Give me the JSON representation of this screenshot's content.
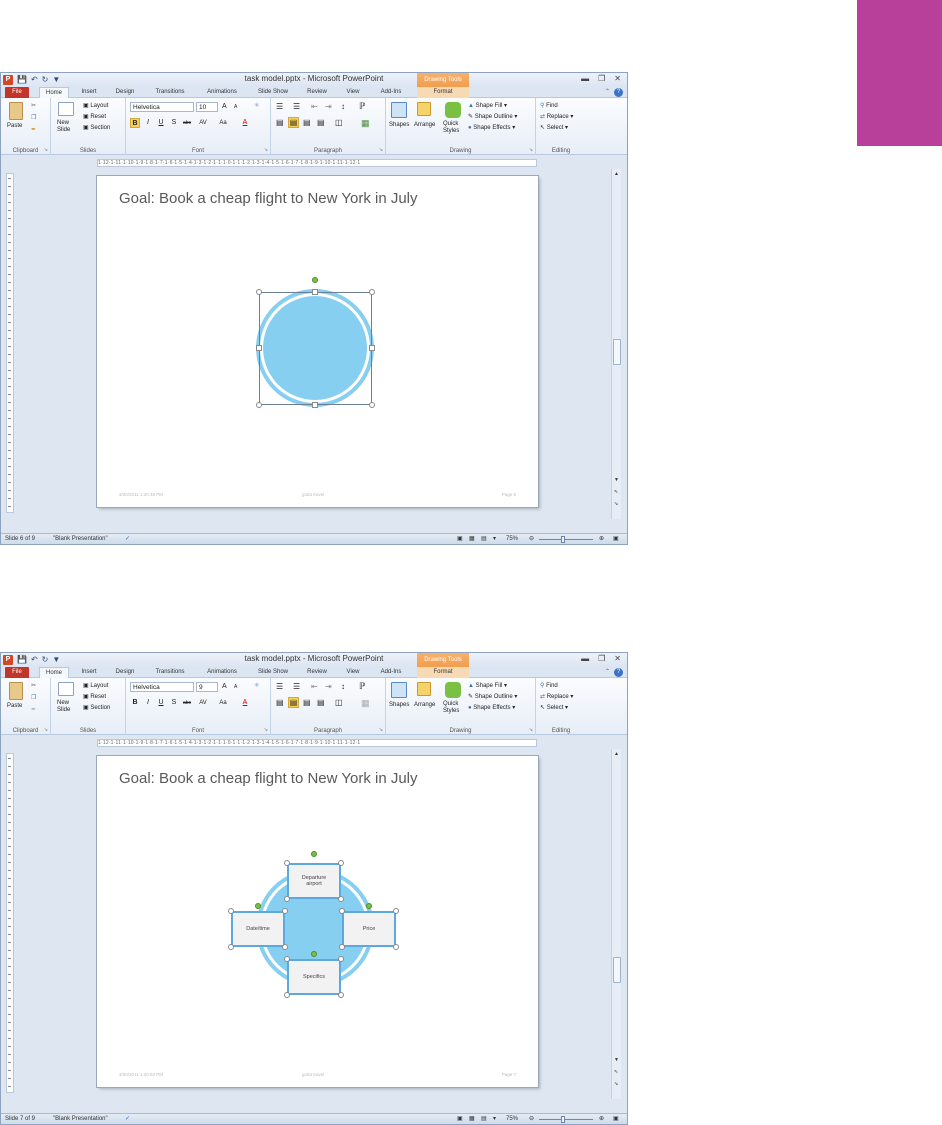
{
  "colors": {
    "accent_block": "#b8409a",
    "circle_fill": "#86cff0",
    "circle_ring": "#86cff0",
    "box_border": "#5ca9e2",
    "file_tab": "#c2352a",
    "drawing_tools_tab": "#f19d4d"
  },
  "windows": [
    {
      "title": "task model.pptx - Microsoft PowerPoint",
      "contextual_tab": "Drawing Tools",
      "tabs": [
        "File",
        "Home",
        "Insert",
        "Design",
        "Transitions",
        "Animations",
        "Slide Show",
        "Review",
        "View",
        "Add-Ins",
        "Format"
      ],
      "ribbon": {
        "clipboard": {
          "label": "Clipboard",
          "paste": "Paste"
        },
        "slides": {
          "label": "Slides",
          "new_slide": "New Slide",
          "layout": "Layout",
          "reset": "Reset",
          "section": "Section"
        },
        "font": {
          "label": "Font",
          "font_name": "Helvetica",
          "font_size": "10",
          "grow": "A",
          "shrink": "A",
          "bold": "B",
          "italic": "I",
          "underline": "U",
          "shadow": "S",
          "strike": "abc",
          "spacing": "AV",
          "case": "Aa",
          "color": "A"
        },
        "paragraph": {
          "label": "Paragraph"
        },
        "drawing": {
          "label": "Drawing",
          "shapes": "Shapes",
          "arrange": "Arrange",
          "quick_styles": "Quick Styles",
          "shape_fill": "Shape Fill",
          "shape_outline": "Shape Outline",
          "shape_effects": "Shape Effects"
        },
        "editing": {
          "label": "Editing",
          "find": "Find",
          "replace": "Replace",
          "select": "Select"
        }
      },
      "ruler_text": "1·12·1·11·1·10·1·9·1·8·1·7·1·6·1·5·1·4·1·3·1·2·1·1·1·0·1·1·1·2·1·3·1·4·1·5·1·6·1·7·1·8·1·9·1·10·1·11·1·12·1",
      "slide": {
        "title": "Goal: Book a cheap flight to New York in July",
        "footer_left": "3/30/2011 1:20:46 PM",
        "footer_center": "gotta travel",
        "footer_right": "Page 6",
        "boxes": []
      },
      "status": {
        "slide": "Slide 6 of 9",
        "theme": "\"Blank Presentation\"",
        "zoom": "75%"
      }
    },
    {
      "title": "task model.pptx - Microsoft PowerPoint",
      "contextual_tab": "Drawing Tools",
      "tabs": [
        "File",
        "Home",
        "Insert",
        "Design",
        "Transitions",
        "Animations",
        "Slide Show",
        "Review",
        "View",
        "Add-Ins",
        "Format"
      ],
      "ribbon": {
        "clipboard": {
          "label": "Clipboard",
          "paste": "Paste"
        },
        "slides": {
          "label": "Slides",
          "new_slide": "New Slide",
          "layout": "Layout",
          "reset": "Reset",
          "section": "Section"
        },
        "font": {
          "label": "Font",
          "font_name": "Helvetica",
          "font_size": "9",
          "grow": "A",
          "shrink": "A",
          "bold": "B",
          "italic": "I",
          "underline": "U",
          "shadow": "S",
          "strike": "abc",
          "spacing": "AV",
          "case": "Aa",
          "color": "A"
        },
        "paragraph": {
          "label": "Paragraph"
        },
        "drawing": {
          "label": "Drawing",
          "shapes": "Shapes",
          "arrange": "Arrange",
          "quick_styles": "Quick Styles",
          "shape_fill": "Shape Fill",
          "shape_outline": "Shape Outline",
          "shape_effects": "Shape Effects"
        },
        "editing": {
          "label": "Editing",
          "find": "Find",
          "replace": "Replace",
          "select": "Select"
        }
      },
      "ruler_text": "1·12·1·11·1·10·1·9·1·8·1·7·1·6·1·5·1·4·1·3·1·2·1·1·1·0·1·1·1·2·1·3·1·4·1·5·1·6·1·7·1·8·1·9·1·10·1·11·1·12·1",
      "slide": {
        "title": "Goal: Book a cheap flight to New York in July",
        "footer_left": "3/30/2011 1:20:52 PM",
        "footer_center": "gotta travel",
        "footer_right": "Page 7",
        "boxes": [
          "Departure airport",
          "Date/time",
          "Price",
          "Specifics"
        ]
      },
      "status": {
        "slide": "Slide 7 of 9",
        "theme": "\"Blank Presentation\"",
        "zoom": "75%"
      }
    }
  ]
}
